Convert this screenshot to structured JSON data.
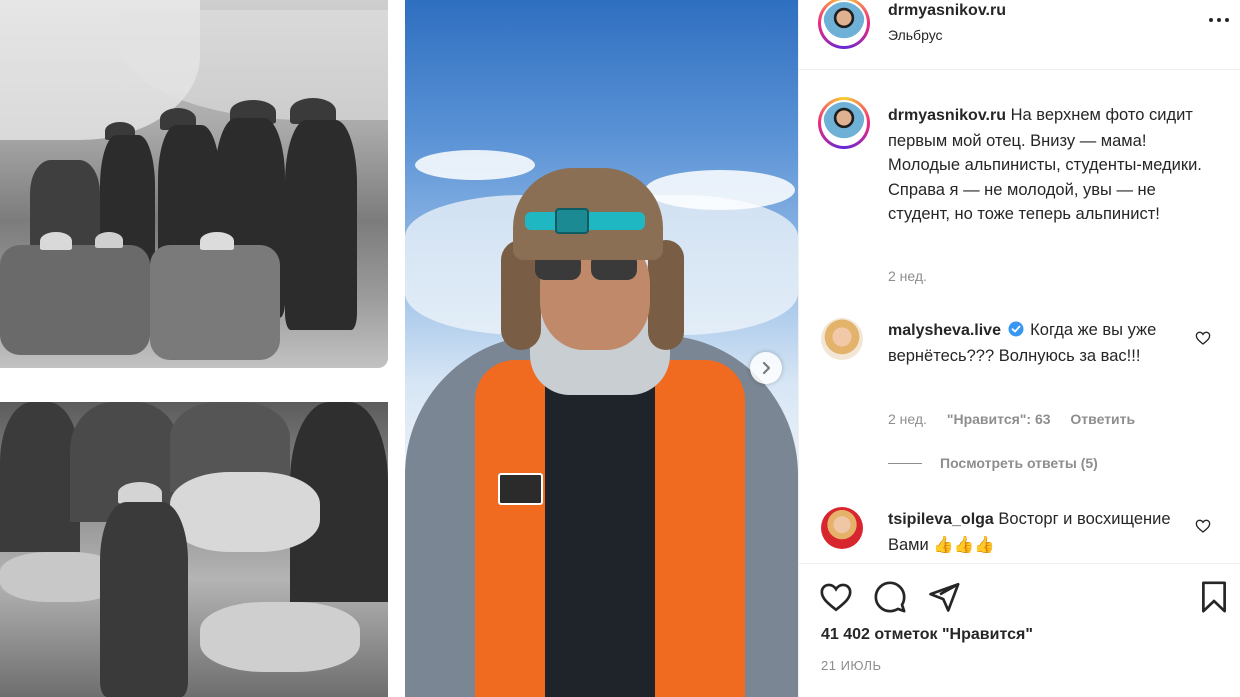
{
  "post": {
    "username": "drmyasnikov.ru",
    "location": "Эльбрус",
    "caption_user": "drmyasnikov.ru",
    "caption_text": "На верхнем фото сидит первым мой отец. Внизу — мама! Молодые альпинисты, студенты-медики. Справа я — не молодой, увы — не студент, но тоже теперь альпинист!",
    "caption_time": "2 нед.",
    "likes": "41 402 отметок \"Нравится\"",
    "date": "21 ИЮЛЬ"
  },
  "comments": [
    {
      "username": "malysheva.live",
      "verified": true,
      "text": "Когда же вы уже вернётесь??? Волнуюсь за вас!!!",
      "time": "2 нед.",
      "likes": "\"Нравится\": 63",
      "reply": "Ответить",
      "view_replies": "Посмотреть ответы (5)"
    },
    {
      "username": "tsipileva_olga",
      "verified": false,
      "text": "Восторг и восхищение Вами 👍👍👍"
    }
  ],
  "icons": {
    "more": "more-horizontal-icon",
    "next": "chevron-right-icon",
    "like": "heart-icon",
    "comment": "comment-icon",
    "share": "paper-plane-icon",
    "save": "bookmark-icon"
  }
}
